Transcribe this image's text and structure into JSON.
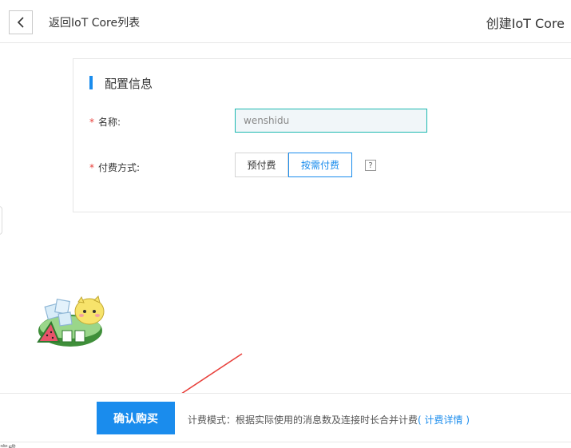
{
  "header": {
    "back_label": "返回IoT Core列表",
    "page_title": "创建IoT Core"
  },
  "config": {
    "section_title": "配置信息",
    "name_label": "名称:",
    "name_value": "wenshidu",
    "required_mark": "*",
    "billing_label": "付费方式:",
    "billing_options": [
      "预付费",
      "按需付费"
    ],
    "selected_billing": "按需付费",
    "help_symbol": "?"
  },
  "footer": {
    "confirm_label": "确认购买",
    "billing_note": "计费模式：根据实际使用的消息数及连接时长合并计费",
    "billing_link": "( 计费详情 )"
  },
  "corner_fragment": "完成",
  "colors": {
    "accent": "#1a8ced",
    "input_border": "#1bb8b0",
    "required": "#e8403b",
    "annotation_arrow": "#e8403b"
  },
  "icons": {
    "back": "chevron-left-icon",
    "help": "question-mark-icon",
    "mascot": "watermelon-ice-mascot-icon",
    "arrow": "red-annotation-arrow-icon"
  }
}
